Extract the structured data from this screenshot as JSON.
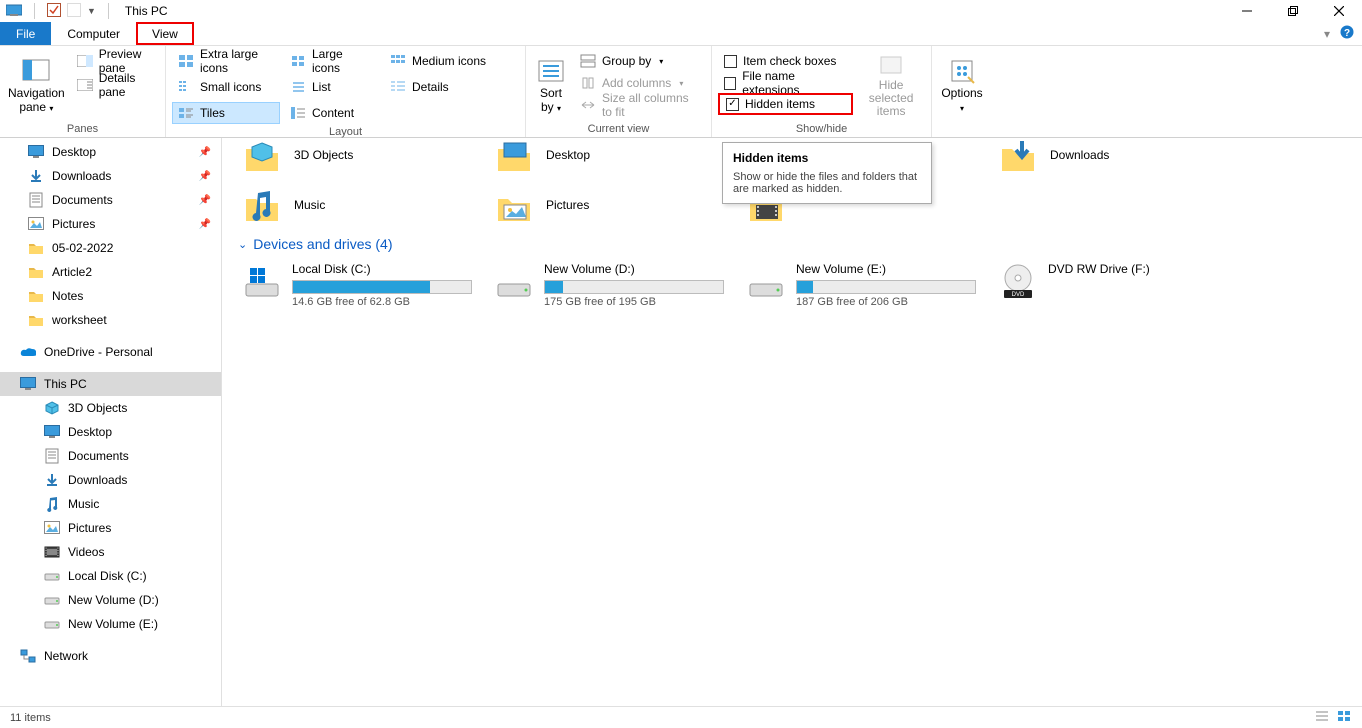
{
  "title": "This PC",
  "tabs": {
    "file": "File",
    "computer": "Computer",
    "view": "View"
  },
  "ribbon": {
    "panes": {
      "navigation": "Navigation\npane",
      "preview": "Preview pane",
      "details": "Details pane",
      "group": "Panes"
    },
    "layout": {
      "xl": "Extra large icons",
      "lg": "Large icons",
      "md": "Medium icons",
      "sm": "Small icons",
      "list": "List",
      "details": "Details",
      "tiles": "Tiles",
      "content": "Content",
      "group": "Layout"
    },
    "current": {
      "sort": "Sort\nby",
      "groupby": "Group by",
      "addcols": "Add columns",
      "sizeall": "Size all columns to fit",
      "group": "Current view"
    },
    "showhide": {
      "itemchk": "Item check boxes",
      "ext": "File name extensions",
      "hidden": "Hidden items",
      "hidesel": "Hide selected\nitems",
      "group": "Show/hide"
    },
    "options": "Options"
  },
  "nav": {
    "desktop": "Desktop",
    "downloads": "Downloads",
    "documents": "Documents",
    "pictures": "Pictures",
    "f_date": "05-02-2022",
    "f_article": "Article2",
    "f_notes": "Notes",
    "f_ws": "worksheet",
    "onedrive": "OneDrive - Personal",
    "thispc": "This PC",
    "objects3d": "3D Objects",
    "desktop2": "Desktop",
    "documents2": "Documents",
    "downloads2": "Downloads",
    "music": "Music",
    "pictures2": "Pictures",
    "videos": "Videos",
    "c": "Local Disk (C:)",
    "d": "New Volume (D:)",
    "e": "New Volume (E:)",
    "network": "Network"
  },
  "folders": {
    "objects3d": "3D Objects",
    "desktop": "Desktop",
    "downloads": "Downloads",
    "music": "Music",
    "pictures": "Pictures"
  },
  "section": "Devices and drives (4)",
  "drives": {
    "c": {
      "name": "Local Disk (C:)",
      "free": "14.6 GB free of 62.8 GB",
      "pct": 77
    },
    "d": {
      "name": "New Volume (D:)",
      "free": "175 GB free of 195 GB",
      "pct": 10
    },
    "e": {
      "name": "New Volume (E:)",
      "free": "187 GB free of 206 GB",
      "pct": 9
    },
    "f": {
      "name": "DVD RW Drive (F:)"
    }
  },
  "tooltip": {
    "title": "Hidden items",
    "body": "Show or hide the files and folders that are marked as hidden."
  },
  "status": "11 items"
}
